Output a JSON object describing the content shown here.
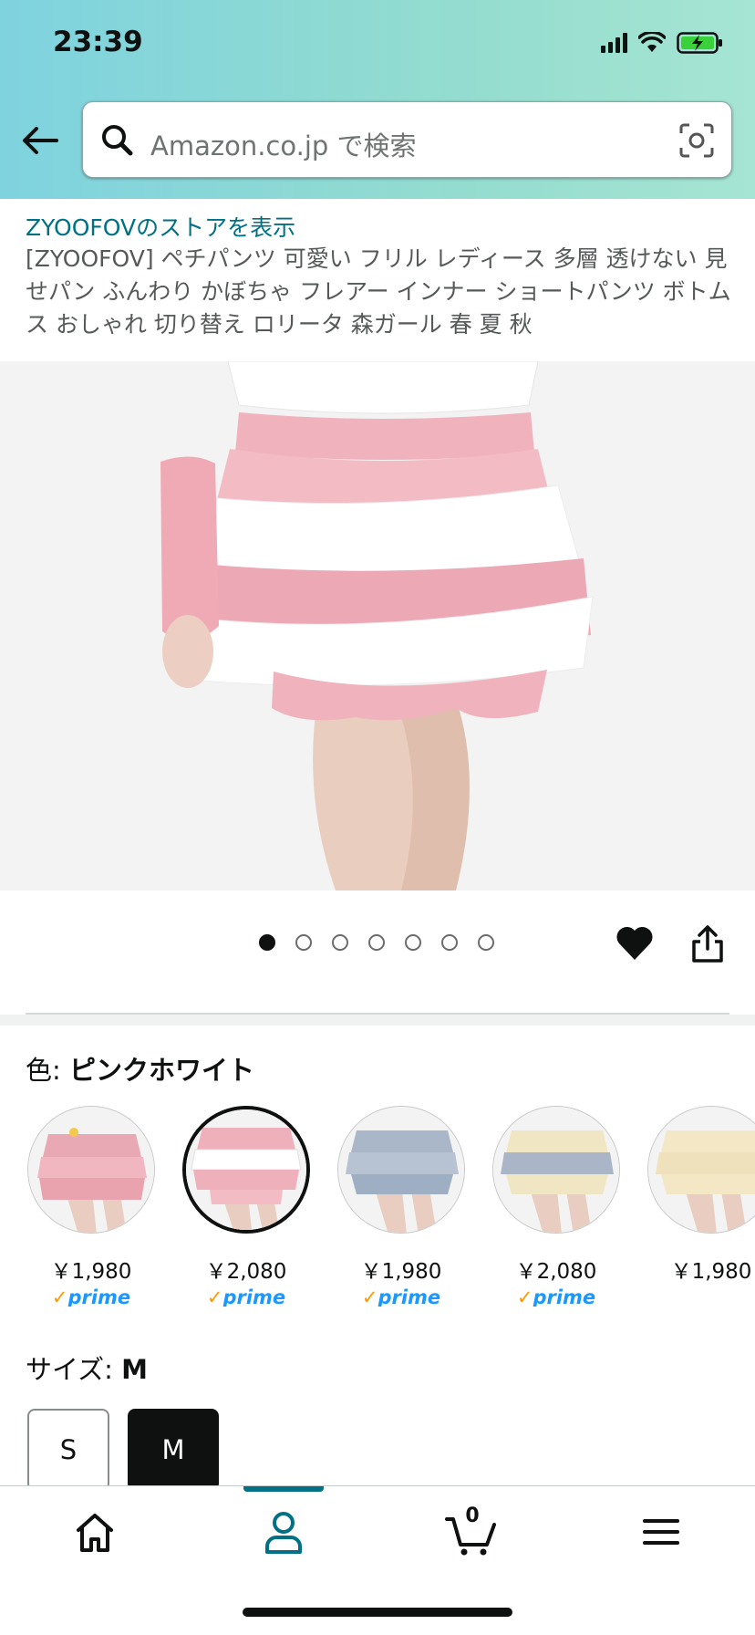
{
  "status_bar": {
    "time": "23:39"
  },
  "search": {
    "placeholder": "Amazon.co.jp で検索"
  },
  "product": {
    "store_link": "ZYOOFOVのストアを表示",
    "title": "[ZYOOFOV] ペチパンツ 可愛い フリル レディース 多層 透けない 見せパン ふんわり かぼちゃ フレアー インナー ショートパンツ ボトムス おしゃれ 切り替え ロリータ 森ガール 春 夏 秋"
  },
  "gallery": {
    "image_count": 7,
    "active_index": 0
  },
  "color": {
    "label": "色: ",
    "selected": "ピンクホワイト",
    "options": [
      {
        "price": "￥1,980",
        "prime": "prime",
        "tiers": [
          "#e8a9b4",
          "#f0b7c0",
          "#e9a3ae"
        ]
      },
      {
        "price": "￥2,080",
        "prime": "prime",
        "tiers": [
          "#eeb1bb",
          "#ffffff",
          "#eeb1bb"
        ]
      },
      {
        "price": "￥1,980",
        "prime": "prime",
        "tiers": [
          "#a9b7c9",
          "#b7c3d3",
          "#9fafc3"
        ]
      },
      {
        "price": "￥2,080",
        "prime": "prime",
        "tiers": [
          "#f1e6c4",
          "#aab6c8",
          "#f1e6c4"
        ]
      },
      {
        "price": "￥1,980",
        "prime": "",
        "tiers": [
          "#f3e7c6",
          "#efe1bb",
          "#f3e7c6"
        ]
      }
    ]
  },
  "size": {
    "label": "サイズ: ",
    "selected": "M",
    "options": [
      "S",
      "M"
    ]
  },
  "bottom_nav": {
    "cart_count": "0"
  },
  "colors": {
    "link": "#007185",
    "prime": "#1a98ff",
    "prime_check": "#ff9900"
  }
}
